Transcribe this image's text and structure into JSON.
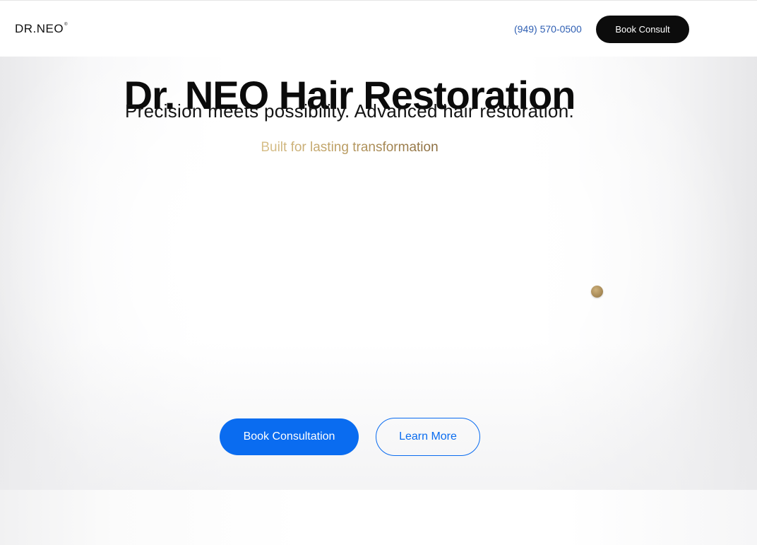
{
  "header": {
    "logo_text": "DR.NEO",
    "logo_mark": "®",
    "phone": "(949) 570-0500",
    "cta_label": "Book Consult"
  },
  "hero": {
    "title": "Dr. NEO Hair Restoration",
    "subtitle": "Precision meets possibility. Advanced hair restoration.",
    "tagline": "Built for lasting transformation",
    "primary_button": "Book Consultation",
    "secondary_button": "Learn More"
  },
  "colors": {
    "primary_blue": "#0a6cf0",
    "header_cta_bg": "#0c0c0c",
    "gold_accent": "#b8995f",
    "phone_link": "#2f5fb3"
  }
}
